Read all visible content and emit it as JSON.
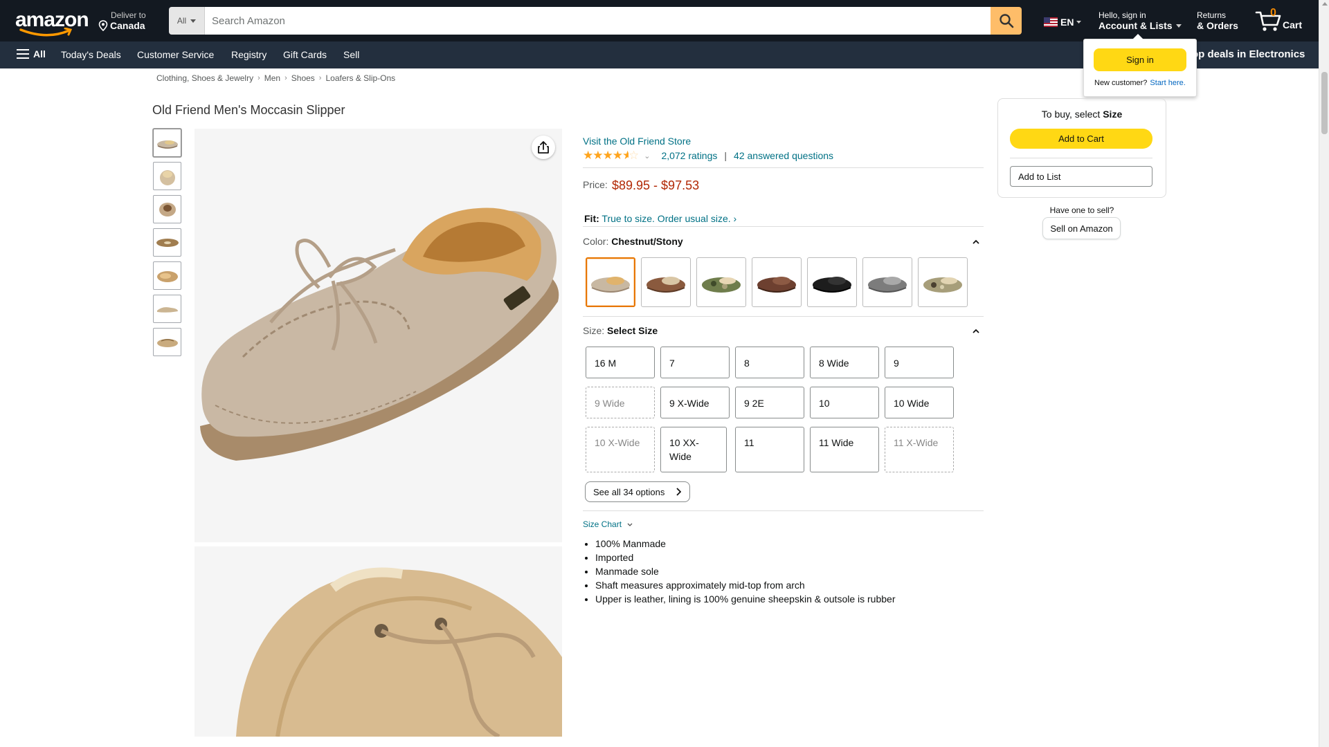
{
  "header": {
    "deliver_line1": "Deliver to",
    "deliver_line2": "Canada",
    "search_category": "All",
    "search_placeholder": "Search Amazon",
    "language": "EN",
    "account_line1": "Hello, sign in",
    "account_line2": "Account & Lists",
    "returns_line1": "Returns",
    "returns_line2": "& Orders",
    "cart_count": "0",
    "cart_label": "Cart"
  },
  "subnav": {
    "all_label": "All",
    "items": [
      "Today's Deals",
      "Customer Service",
      "Registry",
      "Gift Cards",
      "Sell"
    ],
    "promo": "op deals in Electronics"
  },
  "signin_flyout": {
    "button": "Sign in",
    "new_customer": "New customer?",
    "start_here": "Start here."
  },
  "breadcrumb": [
    "Clothing, Shoes & Jewelry",
    "Men",
    "Shoes",
    "Loafers & Slip-Ons"
  ],
  "product": {
    "title": "Old Friend Men's Moccasin Slipper",
    "store_link": "Visit the Old Friend Store",
    "rating_stars": 4.5,
    "ratings_count": "2,072 ratings",
    "answered": "42 answered questions",
    "price_label": "Price:",
    "price": "$89.95 - $97.53",
    "fit_label": "Fit:",
    "fit_value": "True to size. Order usual size. ›",
    "color_label": "Color:",
    "color_value": "Chestnut/Stony",
    "size_label": "Size:",
    "size_value": "Select Size",
    "swatch_colors": [
      "#c8b8a2",
      "#8a5a3e",
      "#6f7d4c",
      "#6d4030",
      "#1d1d1d",
      "#7c7c7c",
      "#a79e7a"
    ],
    "sizes": [
      {
        "label": "16 M",
        "available": true
      },
      {
        "label": "7",
        "available": true
      },
      {
        "label": "8",
        "available": true
      },
      {
        "label": "8 Wide",
        "available": true
      },
      {
        "label": "9",
        "available": true
      },
      {
        "label": "9 Wide",
        "available": false
      },
      {
        "label": "9 X-Wide",
        "available": true
      },
      {
        "label": "9 2E",
        "available": true
      },
      {
        "label": "10",
        "available": true
      },
      {
        "label": "10 Wide",
        "available": true
      },
      {
        "label": "10 X-Wide",
        "available": false
      },
      {
        "label": "10 XX-Wide",
        "available": true
      },
      {
        "label": "11",
        "available": true
      },
      {
        "label": "11 Wide",
        "available": true
      },
      {
        "label": "11 X-Wide",
        "available": false
      }
    ],
    "see_all": "See all 34 options",
    "size_chart": "Size Chart",
    "bullets": [
      "100% Manmade",
      "Imported",
      "Manmade sole",
      "Shaft measures approximately mid-top from arch",
      "Upper is leather, lining is 100% genuine sheepskin & outsole is rubber"
    ]
  },
  "buybox": {
    "title_prefix": "To buy, select",
    "title_bold": "Size",
    "add_to_cart": "Add to Cart",
    "add_to_list": "Add to List",
    "sell_question": "Have one to sell?",
    "sell_button": "Sell on Amazon"
  },
  "colors": {
    "header_bg": "#131921",
    "subnav_bg": "#232f3e",
    "accent_yellow": "#ffd814",
    "link": "#007185",
    "price": "#b12704"
  }
}
